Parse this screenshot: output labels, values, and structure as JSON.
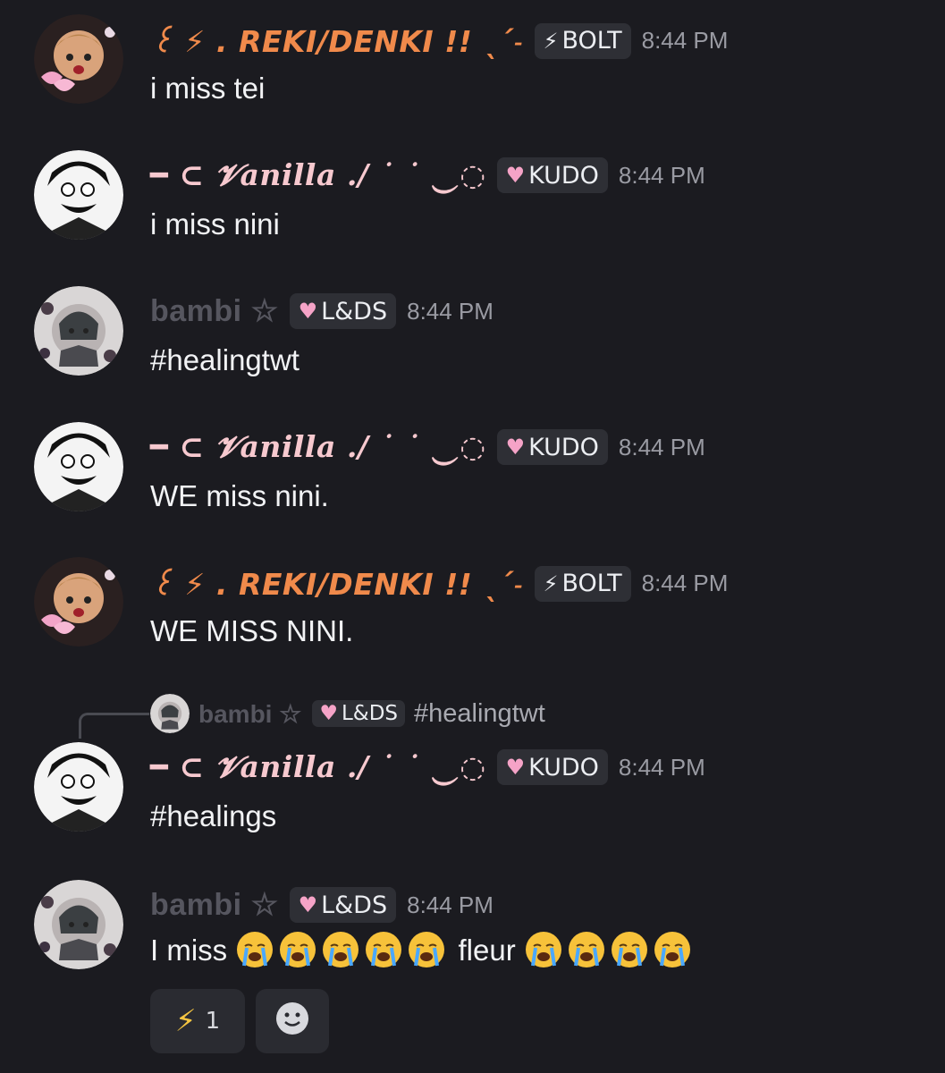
{
  "colors": {
    "bg": "#1b1b20",
    "orange": "#f08a4b",
    "pink": "#f7c9cf",
    "grey": "#56565f",
    "tag_bg": "#2e2f35"
  },
  "messages": [
    {
      "author": "꒰ ⚡︎ . REKI/DENKI !! ˎˊ˗",
      "tag": "BOLT",
      "tag_icon": "lightning-icon",
      "time": "8:44 PM",
      "text": "i miss tei",
      "avatar": "reki-avatar"
    },
    {
      "author": "━ ⊂ 𝓥anilla ./ ˙ ˙ ‿◌",
      "tag": "KUDO",
      "tag_icon": "heart-icon",
      "time": "8:44 PM",
      "text": "i miss nini",
      "avatar": "vanilla-avatar"
    },
    {
      "author": "bambi ☆",
      "tag": "L&DS",
      "tag_icon": "heart-icon",
      "time": "8:44 PM",
      "text": "#healingtwt",
      "avatar": "bambi-avatar"
    },
    {
      "author": "━ ⊂ 𝓥anilla ./ ˙ ˙ ‿◌",
      "tag": "KUDO",
      "tag_icon": "heart-icon",
      "time": "8:44 PM",
      "text": "WE miss nini.",
      "avatar": "vanilla-avatar"
    },
    {
      "author": "꒰ ⚡︎ . REKI/DENKI !! ˎˊ˗",
      "tag": "BOLT",
      "tag_icon": "lightning-icon",
      "time": "8:44 PM",
      "text": "WE MISS NINI.",
      "avatar": "reki-avatar"
    },
    {
      "author": "━ ⊂ 𝓥anilla ./ ˙ ˙ ‿◌",
      "tag": "KUDO",
      "tag_icon": "heart-icon",
      "time": "8:44 PM",
      "text": "#healings",
      "avatar": "vanilla-avatar"
    },
    {
      "author": "bambi ☆",
      "tag": "L&DS",
      "tag_icon": "heart-icon",
      "time": "8:44 PM",
      "text_before": "I miss",
      "text_middle": "fleur",
      "avatar": "bambi-avatar"
    }
  ],
  "reply": {
    "author": "bambi ☆",
    "tag": "L&DS",
    "text": "#healingtwt"
  },
  "reactions": [
    {
      "emoji": "⚡",
      "count": "1"
    },
    {
      "emoji": "add-reaction-icon",
      "count": ""
    }
  ]
}
